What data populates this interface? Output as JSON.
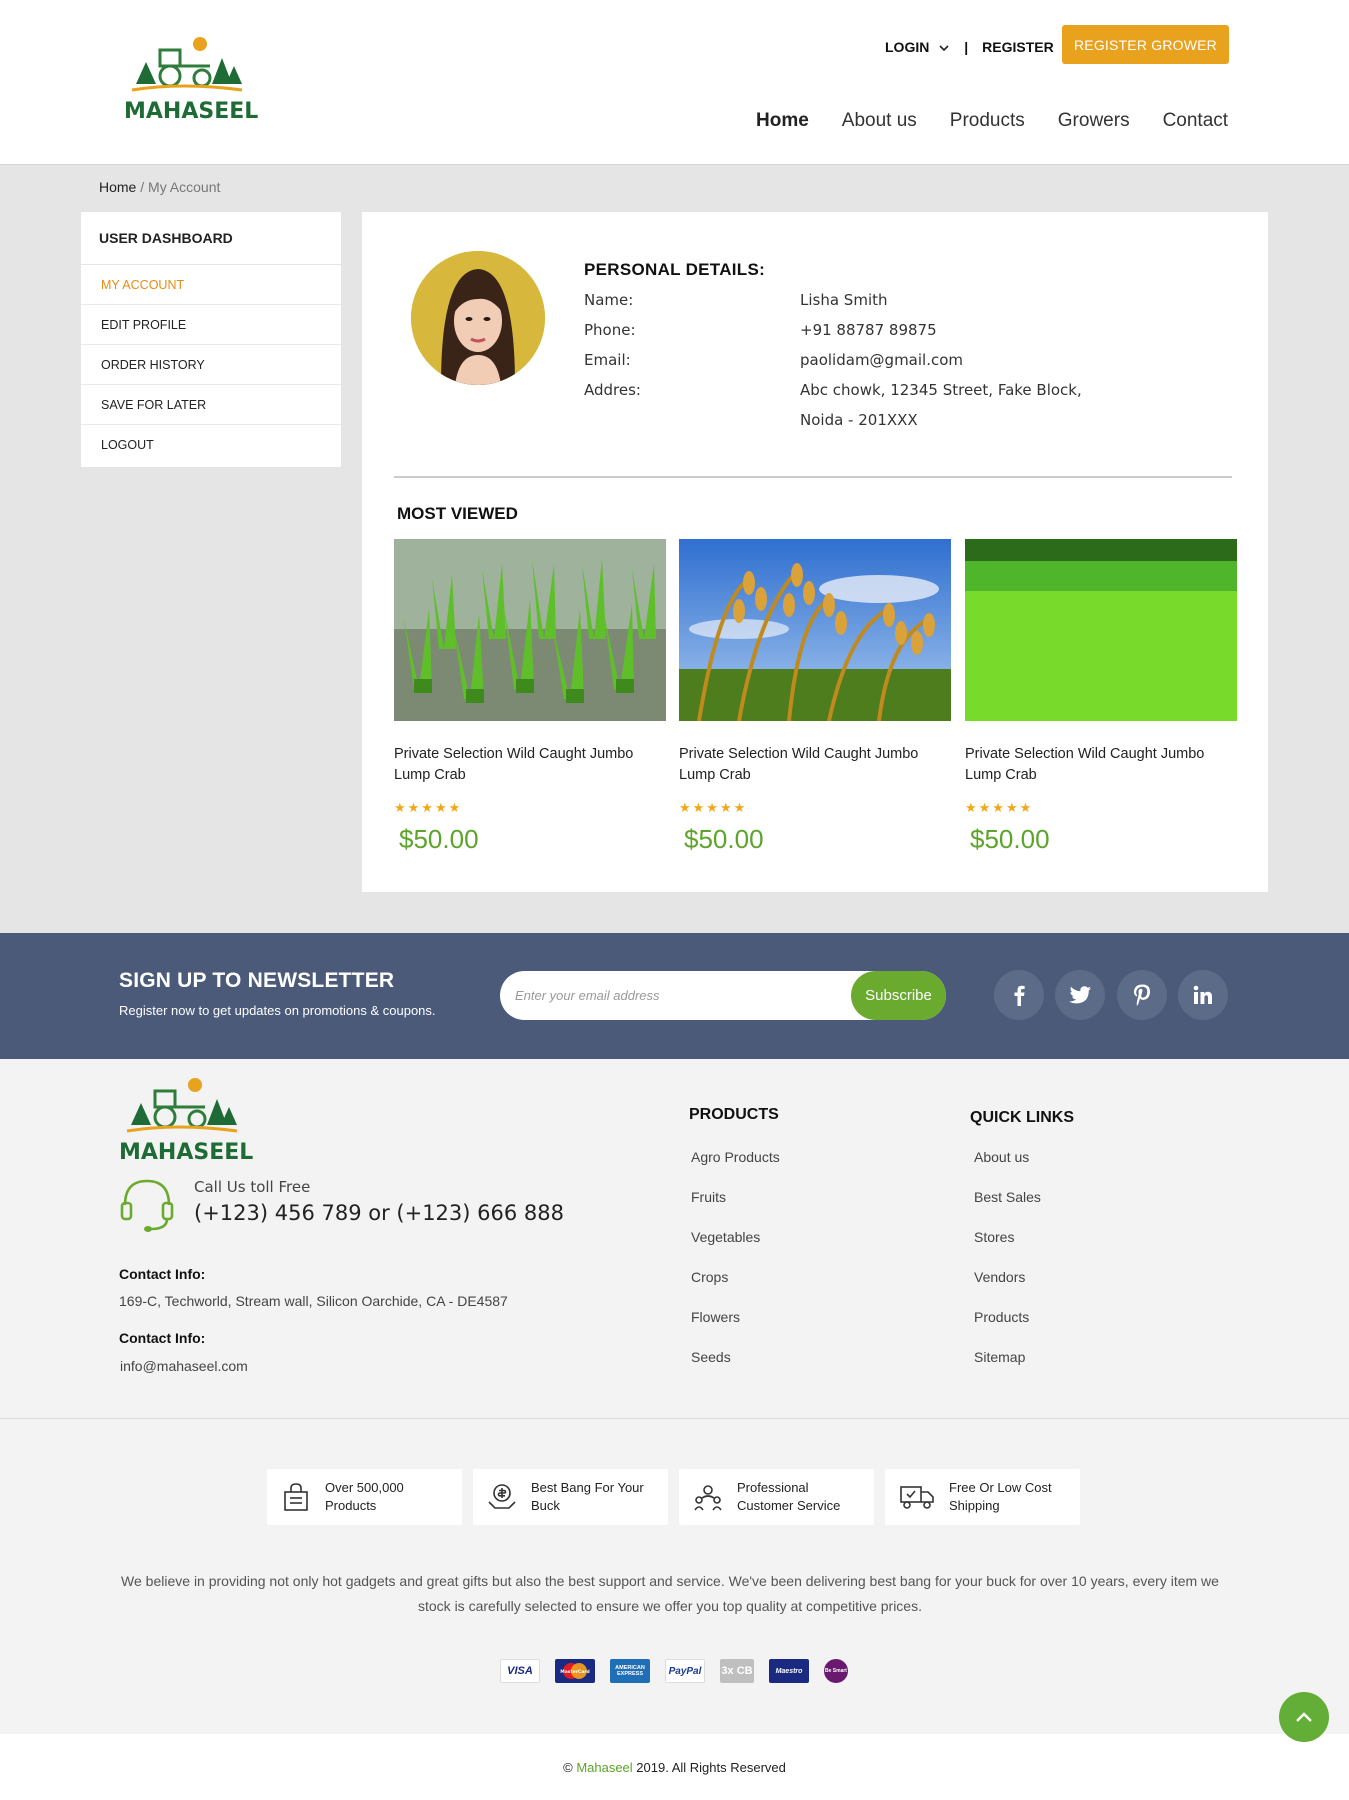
{
  "brand": {
    "name": "MAHASEEL"
  },
  "header": {
    "login": "LOGIN",
    "separator": "|",
    "register": "REGISTER",
    "register_grower": "REGISTER GROWER",
    "nav": [
      "Home",
      "About us",
      "Products",
      "Growers",
      "Contact"
    ]
  },
  "breadcrumb": {
    "home": "Home",
    "sep": " / ",
    "current": "My Account"
  },
  "sidebar": {
    "title": "USER DASHBOARD",
    "items": [
      "MY ACCOUNT",
      "EDIT PROFILE",
      "ORDER HISTORY",
      "SAVE FOR LATER",
      "LOGOUT"
    ]
  },
  "personal": {
    "title": "PERSONAL DETAILS:",
    "labels": [
      "Name:",
      "Phone:",
      "Email:",
      "Addres:"
    ],
    "name": "Lisha Smith",
    "phone": "+91 88787 89875",
    "email": "paolidam@gmail.com",
    "address_line1": "Abc chowk, 12345 Street, Fake Block,",
    "address_line2": "Noida - 201XXX"
  },
  "most_viewed": {
    "title": "MOST VIEWED",
    "products": [
      {
        "name": "Private Selection Wild Caught Jumbo Lump Crab",
        "price": "$50.00",
        "stars": "★★★★★",
        "rating": 5
      },
      {
        "name": "Private Selection Wild Caught Jumbo Lump Crab",
        "price": "$50.00",
        "stars": "★★★★★",
        "rating": 5
      },
      {
        "name": "Private Selection Wild Caught Jumbo Lump Crab",
        "price": "$50.00",
        "stars": "★★★★★",
        "rating": 5
      }
    ]
  },
  "newsletter": {
    "title": "SIGN UP TO NEWSLETTER",
    "subtitle": "Register now to get updates on promotions & coupons.",
    "placeholder": "Enter your email address",
    "button": "Subscribe",
    "social": [
      "facebook-icon",
      "twitter-icon",
      "pinterest-icon",
      "linkedin-icon"
    ]
  },
  "footer": {
    "call_label": "Call Us toll Free",
    "call_number": "(+123) 456 789 or (+123) 666 888",
    "contact_head_1": "Contact Info:",
    "address": "169-C, Techworld, Stream wall, Silicon Oarchide, CA - DE4587",
    "contact_head_2": "Contact Info:",
    "email": "info@mahaseel.com",
    "products_title": "PRODUCTS",
    "products": [
      "Agro Products",
      "Fruits",
      "Vegetables",
      "Crops",
      "Flowers",
      "Seeds"
    ],
    "quick_title": "QUICK LINKS",
    "quick": [
      "About us",
      "Best Sales",
      "Stores",
      "Vendors",
      "Products",
      "Sitemap"
    ],
    "features": [
      {
        "l1": "Over 500,000",
        "l2": "Products"
      },
      {
        "l1": "Best Bang For Your",
        "l2": "Buck"
      },
      {
        "l1": "Professional",
        "l2": "Customer Service"
      },
      {
        "l1": "Free Or Low Cost",
        "l2": "Shipping"
      }
    ],
    "about": "We believe in providing not only hot gadgets and great gifts but also the best support and service. We've been delivering best bang for your buck for over 10 years, every item we stock is carefully selected to ensure we offer you top quality at competitive prices.",
    "payments": [
      "VISA",
      "MasterCard",
      "AMERICAN EXPRESS",
      "PayPal",
      "3x CB",
      "Maestro",
      "Be Smart"
    ],
    "copyright_prefix": "© ",
    "copyright_brand": "Mahaseel",
    "copyright_suffix": " 2019. All Rights Reserved"
  },
  "colors": {
    "accent_orange": "#e9a21d",
    "green": "#5da42a",
    "newsletter_bg": "#4a5a78"
  }
}
